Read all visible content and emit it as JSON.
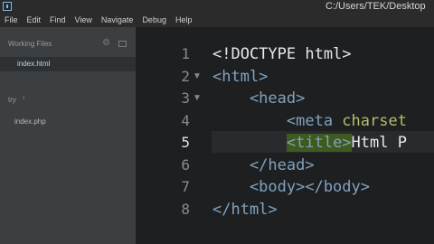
{
  "titlebar": {
    "path": "C:/Users/TEK/Desktop"
  },
  "menu": [
    "File",
    "Edit",
    "Find",
    "View",
    "Navigate",
    "Debug",
    "Help"
  ],
  "sidebar": {
    "working_files_label": "Working Files",
    "active_file": "index.html",
    "folder_label": "try",
    "folder_arrow": "›",
    "files": [
      "index.php"
    ]
  },
  "editor": {
    "active_line": 5,
    "lines": [
      {
        "num": "1",
        "fold": "",
        "parts": [
          {
            "t": "<!DOCTYPE html>",
            "c": "white"
          }
        ]
      },
      {
        "num": "2",
        "fold": "▼",
        "parts": [
          {
            "t": "<html>",
            "c": "blue"
          }
        ]
      },
      {
        "num": "3",
        "fold": "▼",
        "parts": [
          {
            "t": "    <head>",
            "c": "blue"
          }
        ]
      },
      {
        "num": "4",
        "fold": "",
        "parts": [
          {
            "t": "        <meta ",
            "c": "blue"
          },
          {
            "t": "charset",
            "c": "green"
          }
        ]
      },
      {
        "num": "5",
        "fold": "",
        "parts": [
          {
            "t": "        ",
            "c": "white"
          },
          {
            "t": "<title>",
            "c": "hl"
          },
          {
            "t": "Html P",
            "c": "white"
          }
        ]
      },
      {
        "num": "6",
        "fold": "",
        "parts": [
          {
            "t": "    </head>",
            "c": "blue"
          }
        ]
      },
      {
        "num": "7",
        "fold": "",
        "parts": [
          {
            "t": "    <body></body>",
            "c": "blue"
          }
        ]
      },
      {
        "num": "8",
        "fold": "",
        "parts": [
          {
            "t": "</html>",
            "c": "blue"
          }
        ]
      }
    ]
  },
  "colors": {
    "background": "#1d1f21",
    "sidebar": "#3c3f41",
    "tag": "#81a2be",
    "attribute": "#b5bd68",
    "match_highlight": "#3e5a1e"
  }
}
